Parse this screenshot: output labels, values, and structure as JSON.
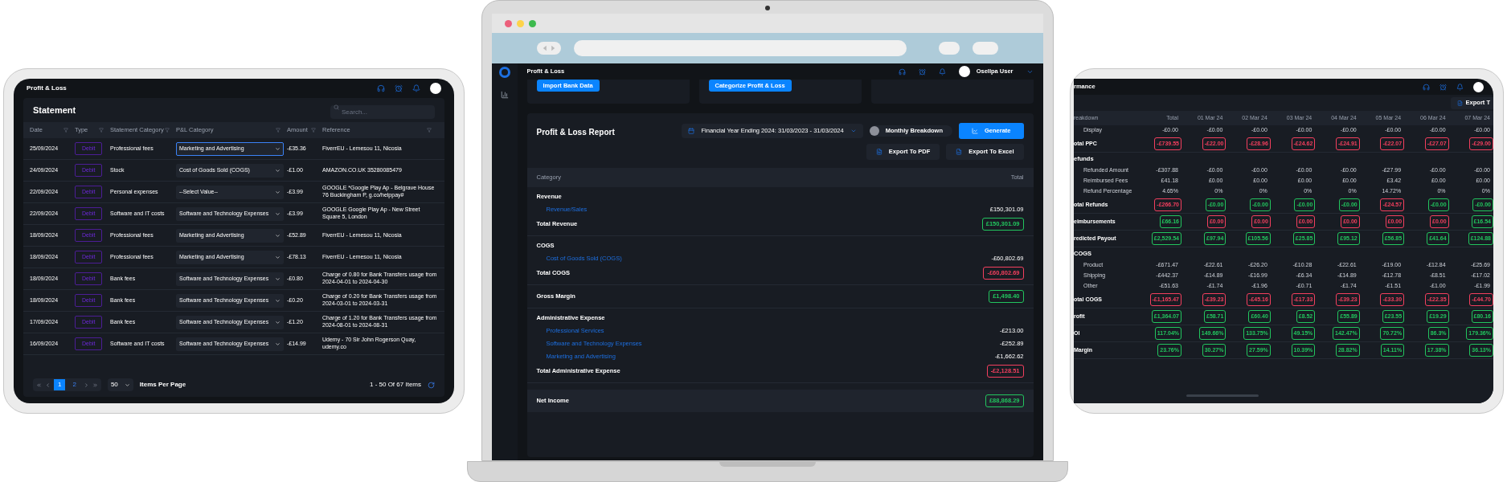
{
  "statement": {
    "page_title": "Profit & Loss",
    "card_title": "Statement",
    "search": {
      "placeholder": "Search..."
    },
    "columns": [
      "Date",
      "Type",
      "Statement Category",
      "P&L Category",
      "Amount",
      "Reference"
    ],
    "rows": [
      {
        "date": "25/09/2024",
        "type": "Debit",
        "statement_category": "Professional fees",
        "pl_category": "Marketing and Advertising",
        "focused": true,
        "amount": "-£35.36",
        "reference": "FiverrEU - Lemesou 11, Nicosia"
      },
      {
        "date": "24/09/2024",
        "type": "Debit",
        "statement_category": "Stock",
        "pl_category": "Cost of Goods Sold (COGS)",
        "focused": false,
        "amount": "-£1.00",
        "reference": "AMAZON.CO.UK 35280085479"
      },
      {
        "date": "22/09/2024",
        "type": "Debit",
        "statement_category": "Personal expenses",
        "pl_category": "--Select Value--",
        "focused": false,
        "amount": "-£3.99",
        "reference": "GOOGLE *Google Play Ap - Belgrave House 76 Buckingham P, g.co/helppay#"
      },
      {
        "date": "22/09/2024",
        "type": "Debit",
        "statement_category": "Software and IT costs",
        "pl_category": "Software and Technology Expenses",
        "focused": false,
        "amount": "-£3.99",
        "reference": "GOOGLE Google Play Ap - New Street Square 5, London"
      },
      {
        "date": "18/09/2024",
        "type": "Debit",
        "statement_category": "Professional fees",
        "pl_category": "Marketing and Advertising",
        "focused": false,
        "amount": "-£52.89",
        "reference": "FiverrEU - Lemesou 11, Nicosia"
      },
      {
        "date": "18/09/2024",
        "type": "Debit",
        "statement_category": "Professional fees",
        "pl_category": "Marketing and Advertising",
        "focused": false,
        "amount": "-£78.13",
        "reference": "FiverrEU - Lemesou 11, Nicosia"
      },
      {
        "date": "18/09/2024",
        "type": "Debit",
        "statement_category": "Bank fees",
        "pl_category": "Software and Technology Expenses",
        "focused": false,
        "amount": "-£0.80",
        "reference": "Charge of 0.80 for Bank Transfers usage from 2024-04-01 to 2024-04-30"
      },
      {
        "date": "18/09/2024",
        "type": "Debit",
        "statement_category": "Bank fees",
        "pl_category": "Software and Technology Expenses",
        "focused": false,
        "amount": "-£0.20",
        "reference": "Charge of 0.20 for Bank Transfers usage from 2024-03-01 to 2024-03-31"
      },
      {
        "date": "17/09/2024",
        "type": "Debit",
        "statement_category": "Bank fees",
        "pl_category": "Software and Technology Expenses",
        "focused": false,
        "amount": "-£1.20",
        "reference": "Charge of 1.20 for Bank Transfers usage from 2024-08-01 to 2024-08-31"
      },
      {
        "date": "16/09/2024",
        "type": "Debit",
        "statement_category": "Software and IT costs",
        "pl_category": "Software and Technology Expenses",
        "focused": false,
        "amount": "-£14.99",
        "reference": "Udemy - 70 Sir John Rogerson Quay, udemy.co"
      }
    ],
    "pagination": {
      "pages": [
        {
          "label": "1",
          "selected": true
        },
        {
          "label": "2",
          "selected": false
        }
      ],
      "page_size": "50",
      "page_size_label": "Items Per Page",
      "summary": "1 - 50 Of 67 Items"
    }
  },
  "report_window": {
    "page_title": "Profit & Loss",
    "user_name": "Osellpa User",
    "actions": [
      "Import Bank Data",
      "Categorize Profit & Loss"
    ],
    "report": {
      "title": "Profit & Loss Report",
      "period": "Financial Year Ending 2024: 31/03/2023 - 31/03/2024",
      "toggle": {
        "label": "Monthly Breakdown",
        "on": false
      },
      "generate": "Generate",
      "exports": [
        {
          "kind": "pdf",
          "label": "Export To PDF"
        },
        {
          "kind": "excel",
          "label": "Export To Excel"
        }
      ],
      "columns": [
        "Category",
        "Total"
      ],
      "sections": [
        {
          "title": "Revenue",
          "items": [
            {
              "label": "Revenue/Sales",
              "value": "£150,301.09"
            }
          ],
          "total": {
            "label": "Total Revenue",
            "value": "£150,301.09",
            "color": "#22c55e"
          }
        },
        {
          "title": "COGS",
          "items": [
            {
              "label": "Cost of Goods Sold (COGS)",
              "value": "-£60,802.69"
            }
          ],
          "total": {
            "label": "Total COGS",
            "value": "-£60,802.69",
            "color": "#f43f5e"
          }
        },
        {
          "total": {
            "label": "Gross Margin",
            "value": "£1,498.40",
            "color": "#22c55e"
          }
        },
        {
          "title": "Administrative Expense",
          "items": [
            {
              "label": "Professional Services",
              "value": "-£213.00"
            },
            {
              "label": "Software and Technology Expenses",
              "value": "-£252.89"
            },
            {
              "label": "Marketing and Advertising",
              "value": "-£1,662.62"
            }
          ],
          "total": {
            "label": "Total Administrative Expense",
            "value": "-£2,128.51",
            "color": "#f43f5e"
          }
        }
      ],
      "net_income": {
        "label": "Net Income",
        "value": "£88,868.29",
        "color": "#22c55e"
      }
    }
  },
  "performance": {
    "page_title": "rmance",
    "export": "Export T",
    "columns": [
      "reakdown",
      "Total",
      "01 Mar 24",
      "02 Mar 24",
      "03 Mar 24",
      "04 Mar 24",
      "05 Mar 24",
      "06 Mar 24",
      "07 Mar 24"
    ],
    "rows": [
      {
        "kind": "item",
        "label": "Display",
        "cells": [
          "-£0.00",
          "-£0.00",
          "-£0.00",
          "-£0.00",
          "-£0.00",
          "-£0.00",
          "-£0.00",
          "-£0.00"
        ]
      },
      {
        "kind": "total",
        "label": "otal PPC",
        "cells": [
          {
            "value": "-£739.55",
            "color": "#f43f5e"
          },
          {
            "value": "-£22.00",
            "color": "#f43f5e"
          },
          {
            "value": "-£28.96",
            "color": "#f43f5e"
          },
          {
            "value": "-£24.62",
            "color": "#f43f5e"
          },
          {
            "value": "-£24.91",
            "color": "#f43f5e"
          },
          {
            "value": "-£22.07",
            "color": "#f43f5e"
          },
          {
            "value": "-£27.07",
            "color": "#f43f5e"
          },
          {
            "value": "-£29.00",
            "color": "#f43f5e"
          }
        ]
      },
      {
        "kind": "heading",
        "label": "efunds"
      },
      {
        "kind": "item",
        "label": "Refunded Amount",
        "cells": [
          "-£307.88",
          "-£0.00",
          "-£0.00",
          "-£0.00",
          "-£0.00",
          "-£27.99",
          "-£0.00",
          "-£0.00"
        ]
      },
      {
        "kind": "item",
        "label": "Reimbursed Fees",
        "cells": [
          "£41.18",
          "£0.00",
          "£0.00",
          "£0.00",
          "£0.00",
          "£3.42",
          "£0.00",
          "£0.00"
        ]
      },
      {
        "kind": "item",
        "label": "Refund Percentage",
        "cells": [
          "4.65%",
          "0%",
          "0%",
          "0%",
          "0%",
          "14.72%",
          "0%",
          "0%"
        ]
      },
      {
        "kind": "total",
        "label": "otal Refunds",
        "cells": [
          {
            "value": "-£266.70",
            "color": "#f43f5e"
          },
          {
            "value": "-£0.00",
            "color": "#22c55e"
          },
          {
            "value": "-£0.00",
            "color": "#22c55e"
          },
          {
            "value": "-£0.00",
            "color": "#22c55e"
          },
          {
            "value": "-£0.00",
            "color": "#22c55e"
          },
          {
            "value": "-£24.57",
            "color": "#f43f5e"
          },
          {
            "value": "-£0.00",
            "color": "#22c55e"
          },
          {
            "value": "-£0.00",
            "color": "#22c55e"
          }
        ]
      },
      {
        "kind": "total",
        "label": "eimbursements",
        "cells": [
          {
            "value": "£66.16",
            "color": "#22c55e"
          },
          {
            "value": "£0.00",
            "color": "#f43f5e"
          },
          {
            "value": "£0.00",
            "color": "#f43f5e"
          },
          {
            "value": "£0.00",
            "color": "#f43f5e"
          },
          {
            "value": "£0.00",
            "color": "#f43f5e"
          },
          {
            "value": "£0.00",
            "color": "#f43f5e"
          },
          {
            "value": "£0.00",
            "color": "#f43f5e"
          },
          {
            "value": "£16.54",
            "color": "#22c55e"
          }
        ]
      },
      {
        "kind": "total",
        "label": "redicted Payout",
        "cells": [
          {
            "value": "£2,529.54",
            "color": "#22c55e"
          },
          {
            "value": "£97.94",
            "color": "#22c55e"
          },
          {
            "value": "£105.56",
            "color": "#22c55e"
          },
          {
            "value": "£25.85",
            "color": "#22c55e"
          },
          {
            "value": "£95.12",
            "color": "#22c55e"
          },
          {
            "value": "£56.85",
            "color": "#22c55e"
          },
          {
            "value": "£41.64",
            "color": "#22c55e"
          },
          {
            "value": "£124.88",
            "color": "#22c55e"
          }
        ]
      },
      {
        "kind": "heading",
        "label": "COGS"
      },
      {
        "kind": "item",
        "label": "Product",
        "cells": [
          "-£671.47",
          "-£22.61",
          "-£26.20",
          "-£10.28",
          "-£22.61",
          "-£19.00",
          "-£12.84",
          "-£25.69"
        ]
      },
      {
        "kind": "item",
        "label": "Shipping",
        "cells": [
          "-£442.37",
          "-£14.89",
          "-£16.99",
          "-£6.34",
          "-£14.89",
          "-£12.78",
          "-£8.51",
          "-£17.02"
        ]
      },
      {
        "kind": "item",
        "label": "Other",
        "cells": [
          "-£51.63",
          "-£1.74",
          "-£1.96",
          "-£0.71",
          "-£1.74",
          "-£1.51",
          "-£1.00",
          "-£1.99"
        ]
      },
      {
        "kind": "total",
        "label": "otal COGS",
        "cells": [
          {
            "value": "-£1,165.47",
            "color": "#f43f5e"
          },
          {
            "value": "-£39.23",
            "color": "#f43f5e"
          },
          {
            "value": "-£45.16",
            "color": "#f43f5e"
          },
          {
            "value": "-£17.33",
            "color": "#f43f5e"
          },
          {
            "value": "-£39.23",
            "color": "#f43f5e"
          },
          {
            "value": "-£33.30",
            "color": "#f43f5e"
          },
          {
            "value": "-£22.35",
            "color": "#f43f5e"
          },
          {
            "value": "-£44.70",
            "color": "#f43f5e"
          }
        ]
      },
      {
        "kind": "total",
        "label": "rofit",
        "cells": [
          {
            "value": "£1,364.07",
            "color": "#22c55e"
          },
          {
            "value": "£58.71",
            "color": "#22c55e"
          },
          {
            "value": "£60.40",
            "color": "#22c55e"
          },
          {
            "value": "£8.52",
            "color": "#22c55e"
          },
          {
            "value": "£55.89",
            "color": "#22c55e"
          },
          {
            "value": "£23.55",
            "color": "#22c55e"
          },
          {
            "value": "£19.29",
            "color": "#22c55e"
          },
          {
            "value": "£80.16",
            "color": "#22c55e"
          }
        ]
      },
      {
        "kind": "total",
        "label": "OI",
        "cells": [
          {
            "value": "117.04%",
            "color": "#22c55e"
          },
          {
            "value": "149.66%",
            "color": "#22c55e"
          },
          {
            "value": "133.75%",
            "color": "#22c55e"
          },
          {
            "value": "49.15%",
            "color": "#22c55e"
          },
          {
            "value": "142.47%",
            "color": "#22c55e"
          },
          {
            "value": "70.72%",
            "color": "#22c55e"
          },
          {
            "value": "86.3%",
            "color": "#22c55e"
          },
          {
            "value": "179.36%",
            "color": "#22c55e"
          }
        ]
      },
      {
        "kind": "total",
        "label": "Margin",
        "cells": [
          {
            "value": "23.76%",
            "color": "#22c55e"
          },
          {
            "value": "30.27%",
            "color": "#22c55e"
          },
          {
            "value": "27.59%",
            "color": "#22c55e"
          },
          {
            "value": "10.39%",
            "color": "#22c55e"
          },
          {
            "value": "28.82%",
            "color": "#22c55e"
          },
          {
            "value": "14.11%",
            "color": "#22c55e"
          },
          {
            "value": "17.38%",
            "color": "#22c55e"
          },
          {
            "value": "36.13%",
            "color": "#22c55e"
          }
        ]
      }
    ]
  }
}
